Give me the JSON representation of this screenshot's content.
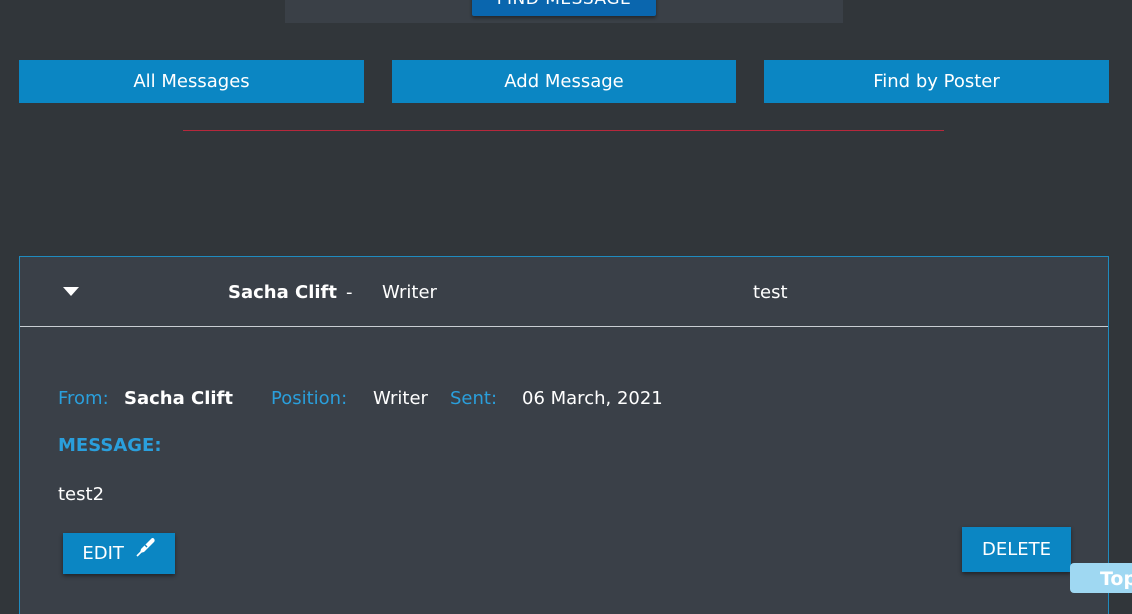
{
  "search_panel": {
    "find_button_label": "FIND MESSAGE"
  },
  "nav": {
    "all_messages": "All Messages",
    "add_message": "Add Message",
    "find_by_poster": "Find by Poster"
  },
  "message_card": {
    "header": {
      "name": "Sacha Clift",
      "separator": "-",
      "position": "Writer",
      "subject": "test"
    },
    "details": {
      "from_label": "From:",
      "from_value": "Sacha Clift",
      "position_label": "Position:",
      "position_value": "Writer",
      "sent_label": "Sent:",
      "sent_value": "06 March, 2021",
      "message_label": "MESSAGE:",
      "message_body": "test2"
    },
    "edit_label": "EDIT",
    "delete_label": "DELETE"
  },
  "scroll_top_label": "Top",
  "colors": {
    "background": "#31363a",
    "card": "#3a4048",
    "accent": "#0b86c3",
    "label": "#2a9fdc",
    "divider": "#b6283c"
  },
  "icons": {
    "caret": "caret-down-icon",
    "edit": "pen-icon"
  }
}
